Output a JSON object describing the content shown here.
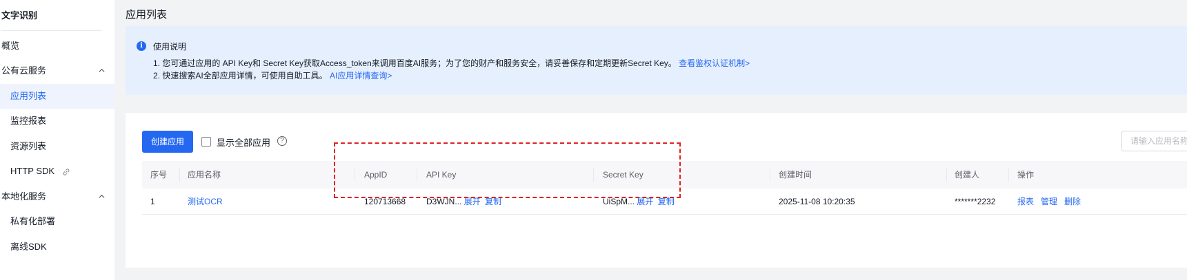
{
  "sidebar": {
    "title": "文字识别",
    "items": [
      {
        "label": "概览"
      },
      {
        "label": "公有云服务"
      },
      {
        "label": "应用列表"
      },
      {
        "label": "监控报表"
      },
      {
        "label": "资源列表"
      },
      {
        "label": "HTTP SDK"
      },
      {
        "label": "本地化服务"
      },
      {
        "label": "私有化部署"
      },
      {
        "label": "离线SDK"
      }
    ]
  },
  "page": {
    "title": "应用列表"
  },
  "notice": {
    "title": "使用说明",
    "line1": "1. 您可通过应用的 API Key和 Secret Key获取Access_token来调用百度AI服务；为了您的财产和服务安全，请妥善保存和定期更新Secret Key。",
    "line1_link": "查看鉴权认证机制>",
    "line2": "2. 快速搜索AI全部应用详情，可使用自助工具。",
    "line2_link": "AI应用详情查询>"
  },
  "toolbar": {
    "create_label": "创建应用",
    "show_all_label": "显示全部应用",
    "search_placeholder": "请输入应用名称"
  },
  "table": {
    "headers": [
      "序号",
      "应用名称",
      "AppID",
      "API Key",
      "Secret Key",
      "创建时间",
      "创建人",
      "操作"
    ],
    "rows": [
      {
        "index": "1",
        "name": "测试OCR",
        "app_id": "120713668",
        "api_key": "D3WJN...",
        "secret_key": "UiSpM...",
        "expand": "展开",
        "copy": "复制",
        "created": "2025-11-08 10:20:35",
        "creator": "*******2232",
        "ops": [
          "报表",
          "管理",
          "删除"
        ]
      }
    ]
  },
  "colors": {
    "accent": "#2468f2",
    "highlight": "#e02020",
    "notice_bg": "#e6effd"
  }
}
